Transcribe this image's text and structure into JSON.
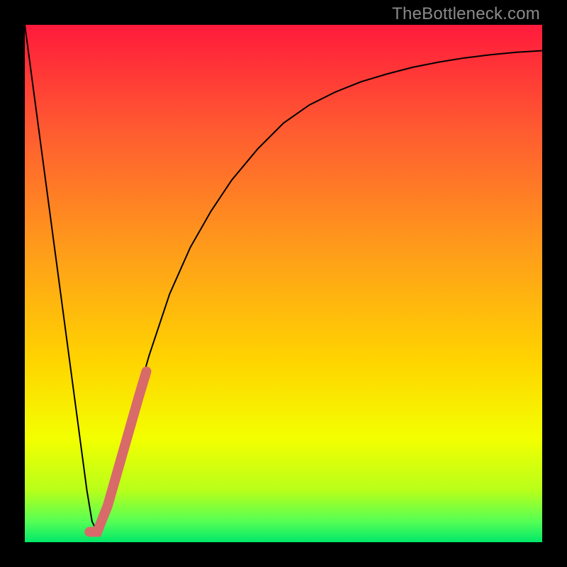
{
  "watermark": "TheBottleneck.com",
  "chart_data": {
    "type": "line",
    "title": "",
    "xlabel": "",
    "ylabel": "",
    "xlim": [
      0,
      100
    ],
    "ylim": [
      0,
      100
    ],
    "axes_visible": false,
    "background": {
      "type": "vertical-gradient",
      "stops": [
        {
          "pos": 0.0,
          "color": "#ff1a3c"
        },
        {
          "pos": 0.2,
          "color": "#ff5a31"
        },
        {
          "pos": 0.45,
          "color": "#ffa019"
        },
        {
          "pos": 0.65,
          "color": "#ffd400"
        },
        {
          "pos": 0.8,
          "color": "#f3ff00"
        },
        {
          "pos": 0.9,
          "color": "#b8ff1a"
        },
        {
          "pos": 0.96,
          "color": "#55ff55"
        },
        {
          "pos": 1.0,
          "color": "#00e86a"
        }
      ]
    },
    "series": [
      {
        "name": "bottleneck-curve",
        "stroke": "#000000",
        "stroke_width": 2,
        "x": [
          0,
          2,
          4,
          6,
          8,
          10,
          12,
          13,
          14,
          16,
          18,
          20,
          24,
          28,
          32,
          36,
          40,
          45,
          50,
          55,
          60,
          65,
          70,
          75,
          80,
          85,
          90,
          95,
          100
        ],
        "values": [
          100,
          85,
          70,
          55,
          40,
          25,
          10,
          4,
          2,
          6,
          14,
          22,
          36,
          48,
          57,
          64,
          70,
          76,
          81,
          84.5,
          87,
          89,
          90.5,
          91.8,
          92.8,
          93.6,
          94.2,
          94.7,
          95
        ]
      },
      {
        "name": "highlight-segment",
        "stroke": "#d86a6a",
        "stroke_width": 14,
        "linecap": "round",
        "x": [
          12.5,
          14,
          16,
          18,
          20,
          22,
          23.5
        ],
        "values": [
          2,
          2,
          7,
          14,
          21,
          28,
          33
        ]
      }
    ]
  }
}
